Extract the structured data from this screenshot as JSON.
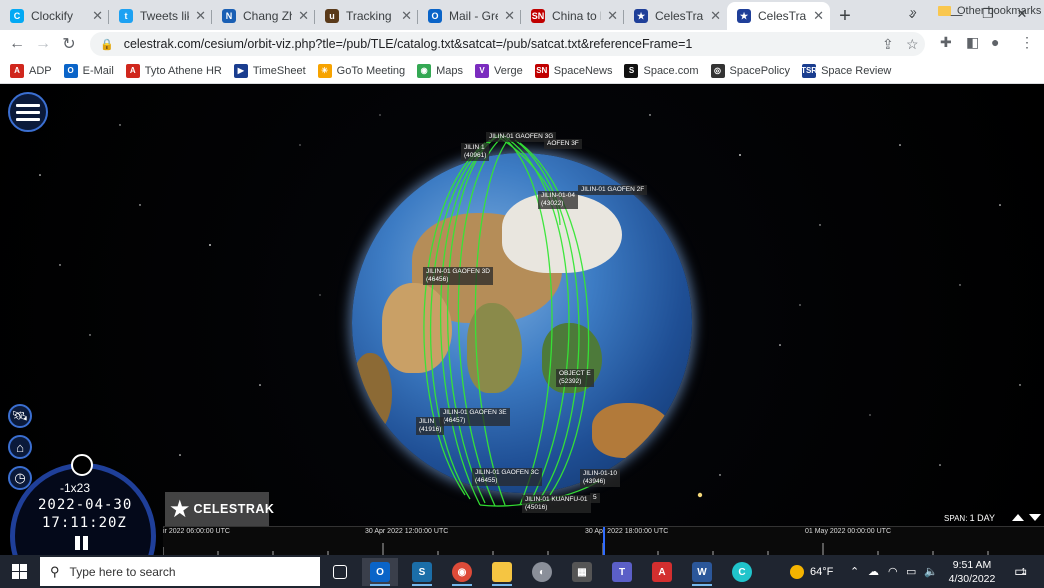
{
  "browser": {
    "tabs": [
      {
        "label": "Clockify",
        "icon": "clockify-icon",
        "color": "#03a9f4"
      },
      {
        "label": "Tweets liked",
        "icon": "twitter-icon",
        "color": "#1da1f2"
      },
      {
        "label": "Chang Zheng",
        "icon": "n-logo-icon",
        "color": "#1a5fb4"
      },
      {
        "label": "Tracking | UPS",
        "icon": "ups-icon",
        "color": "#5a3a1a"
      },
      {
        "label": "Mail - Greg",
        "icon": "outlook-icon",
        "color": "#0a64c8"
      },
      {
        "label": "China to bu",
        "icon": "spacenews-icon",
        "color": "#c00000"
      },
      {
        "label": "CelesTrak",
        "icon": "celestrak-icon",
        "color": "#1f3f99"
      },
      {
        "label": "CelesTrak O",
        "icon": "celestrak-icon",
        "color": "#1f3f99"
      }
    ],
    "active_tab_index": 7,
    "url": "celestrak.com/cesium/orbit-viz.php?tle=/pub/TLE/catalog.txt&satcat=/pub/satcat.txt&referenceFrame=1",
    "bookmarks": [
      {
        "label": "ADP",
        "icon": "adp-icon",
        "color": "#d0271d"
      },
      {
        "label": "E-Mail",
        "icon": "outlook-icon",
        "color": "#0a64c8"
      },
      {
        "label": "Tyto Athene HR",
        "icon": "adp-icon",
        "color": "#d0271d"
      },
      {
        "label": "TimeSheet",
        "icon": "timesheet-icon",
        "color": "#1a3d8f"
      },
      {
        "label": "GoTo Meeting",
        "icon": "gotomeeting-icon",
        "color": "#f7a300"
      },
      {
        "label": "Maps",
        "icon": "maps-icon",
        "color": "#34a853"
      },
      {
        "label": "Verge",
        "icon": "verge-icon",
        "color": "#7b2cbf"
      },
      {
        "label": "SpaceNews",
        "icon": "spacenews-icon",
        "color": "#c00000"
      },
      {
        "label": "Space.com",
        "icon": "space-com-icon",
        "color": "#111111"
      },
      {
        "label": "SpacePolicy",
        "icon": "spacepolicy-icon",
        "color": "#333333"
      },
      {
        "label": "Space Review",
        "icon": "spacereview-icon",
        "color": "#1a3d8f"
      }
    ],
    "more_label": "»",
    "other_bookmarks": "Other bookmarks"
  },
  "viewer": {
    "satellites": [
      "JILIN-01 GAOFEN 3G",
      "JILIN 1",
      "(40961)",
      "AOFEN 3F",
      "JILIN-01 GAOFEN 2F",
      "JILIN-01-04",
      "(43022)",
      "JILIN-01 GAOFEN 3D",
      "(46456)",
      "OBJECT E",
      "(52392)",
      "JILIN-01 GAOFEN 3E",
      "(46457)",
      "JILIN",
      "(41916)",
      "JILIN-01 GAOFEN 3C",
      "(46455)",
      "JILIN-01-10",
      "(43946)",
      "JILIN-01 KUANFU-01",
      "(45016)",
      "5"
    ],
    "orbit_color": "#35e635",
    "clock": {
      "rate": "-1x23",
      "date": "2022-04-30",
      "time": "17:11:20Z"
    },
    "logo": "CELESTRAK",
    "timeline_labels": [
      "ir 2022 06:00:00 UTC",
      "30 Apr 2022 12:00:00 UTC",
      "30 Apr 2022 18:00:00 UTC",
      "01 May 2022 00:00:00 UTC"
    ],
    "span": {
      "label": "SPAN:",
      "value": "1 DAY"
    }
  },
  "taskbar": {
    "search_placeholder": "Type here to search",
    "weather": "64°F",
    "time": "9:51 AM",
    "date": "4/30/2022",
    "notification_count": "1"
  }
}
